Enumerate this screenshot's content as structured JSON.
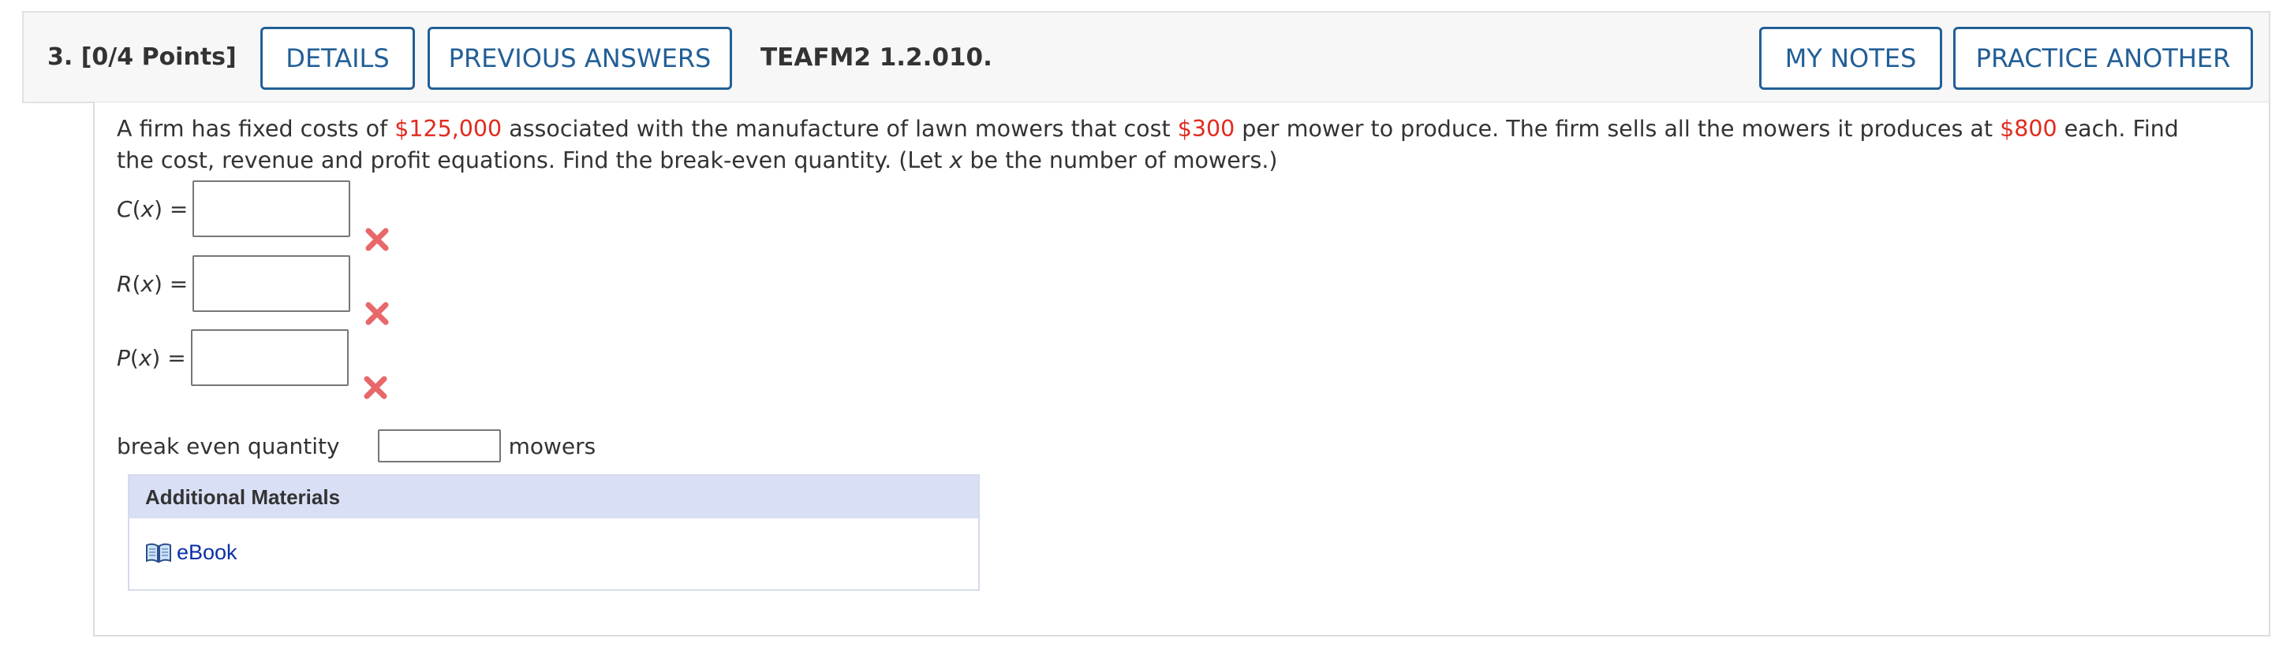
{
  "header": {
    "question_label": "3.  [0/4 Points]",
    "details_label": "DETAILS",
    "previous_answers_label": "PREVIOUS ANSWERS",
    "question_id": "TEAFM2 1.2.010.",
    "my_notes_label": "MY NOTES",
    "practice_another_label": "PRACTICE ANOTHER"
  },
  "question": {
    "part1": "A firm has fixed costs of ",
    "fixed_cost": "$125,000",
    "part2": " associated with the manufacture of lawn mowers that cost ",
    "unit_cost": "$300",
    "part3": " per mower to produce. The firm sells all the mowers it produces at ",
    "price": "$800",
    "part4": " each. Find the cost, revenue and profit equations. Find the break-even quantity. (Let ",
    "variable": "x",
    "part5": " be the number of mowers.)"
  },
  "equations": [
    {
      "func": "C",
      "var": "x",
      "suffix": ") =",
      "value": "",
      "status": "incorrect"
    },
    {
      "func": "R",
      "var": "x",
      "suffix": ") =",
      "value": "",
      "status": "incorrect"
    },
    {
      "func": "P",
      "var": "x",
      "suffix": ") =",
      "value": "",
      "status": "incorrect"
    }
  ],
  "break_even": {
    "label": "break even quantity",
    "value": "",
    "unit": "mowers"
  },
  "materials": {
    "heading": "Additional Materials",
    "ebook_label": "eBook"
  },
  "colors": {
    "accent": "#225f97",
    "highlight_red": "#e02b20",
    "incorrect_mark": "#e8676b",
    "materials_header": "#d9dff5",
    "link": "#0b2fa8"
  }
}
